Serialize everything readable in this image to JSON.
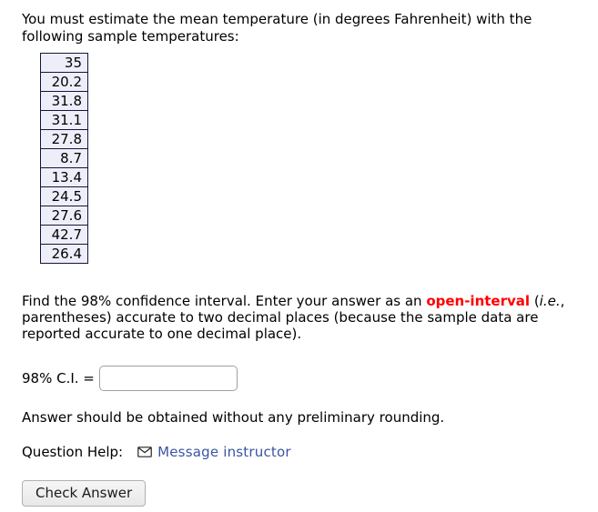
{
  "prompt": {
    "text": "You must estimate the mean temperature (in degrees Fahrenheit) with the following sample temperatures:"
  },
  "sample_table": {
    "values": [
      "35",
      "20.2",
      "31.8",
      "31.1",
      "27.8",
      "8.7",
      "13.4",
      "24.5",
      "27.6",
      "42.7",
      "26.4"
    ]
  },
  "instructions": {
    "part1": "Find the 98% confidence interval. Enter your answer as an ",
    "emphasis": "open-interval",
    "part2": " (",
    "italic": "i.e.",
    "part3": ", parentheses) accurate to two decimal places (because the sample data are reported accurate to one decimal place)."
  },
  "answer": {
    "label": "98% C.I. =",
    "value": "",
    "placeholder": ""
  },
  "note": {
    "text": "Answer should be obtained without any preliminary rounding."
  },
  "question_help": {
    "label": "Question Help:",
    "icon": "envelope-icon",
    "link_text": "Message instructor"
  },
  "actions": {
    "check_answer_label": "Check Answer"
  },
  "colors": {
    "emphasis_red": "#ff0000",
    "link_blue": "#3a54a4",
    "table_cell_bg": "#eeeefa",
    "table_border": "#15153a"
  }
}
